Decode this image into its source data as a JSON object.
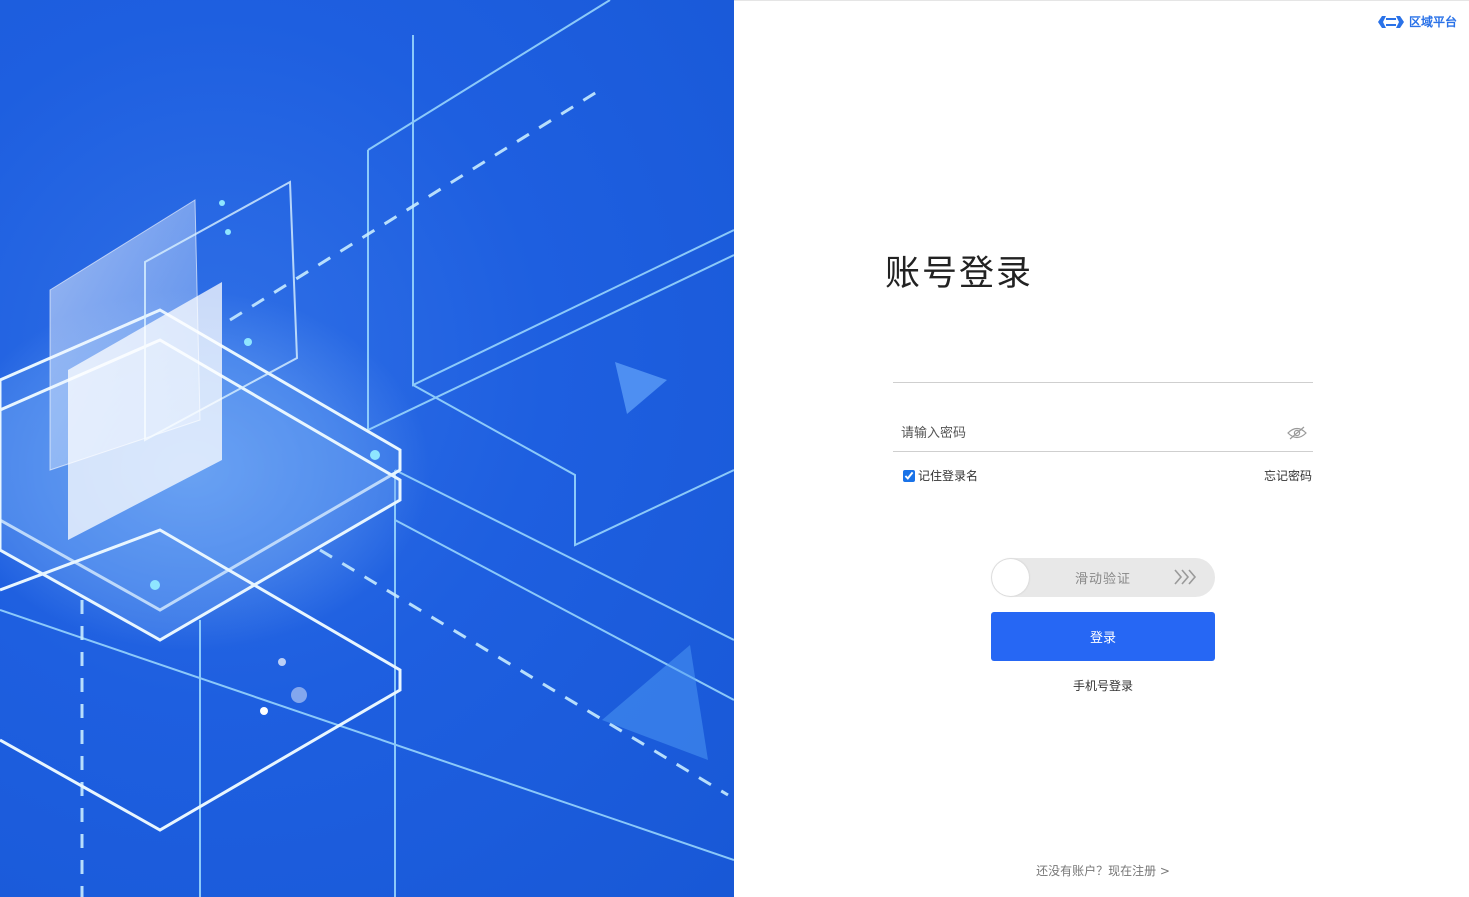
{
  "brand": {
    "name": "区域平台",
    "logo_icon": "brand-logo-icon",
    "color": "#2a72e8"
  },
  "login": {
    "title": "账号登录",
    "username": {
      "value": "",
      "placeholder": ""
    },
    "password": {
      "value": "",
      "placeholder": "请输入密码"
    },
    "remember_label": "记住登录名",
    "remember_checked": true,
    "forgot_label": "忘记密码",
    "slider_label": "滑动验证",
    "submit_label": "登录",
    "phone_login_label": "手机号登录",
    "register_prompt": "还没有账户？现在注册 >"
  },
  "colors": {
    "primary": "#2667f4",
    "hero_bg": "#1e5fe0"
  }
}
